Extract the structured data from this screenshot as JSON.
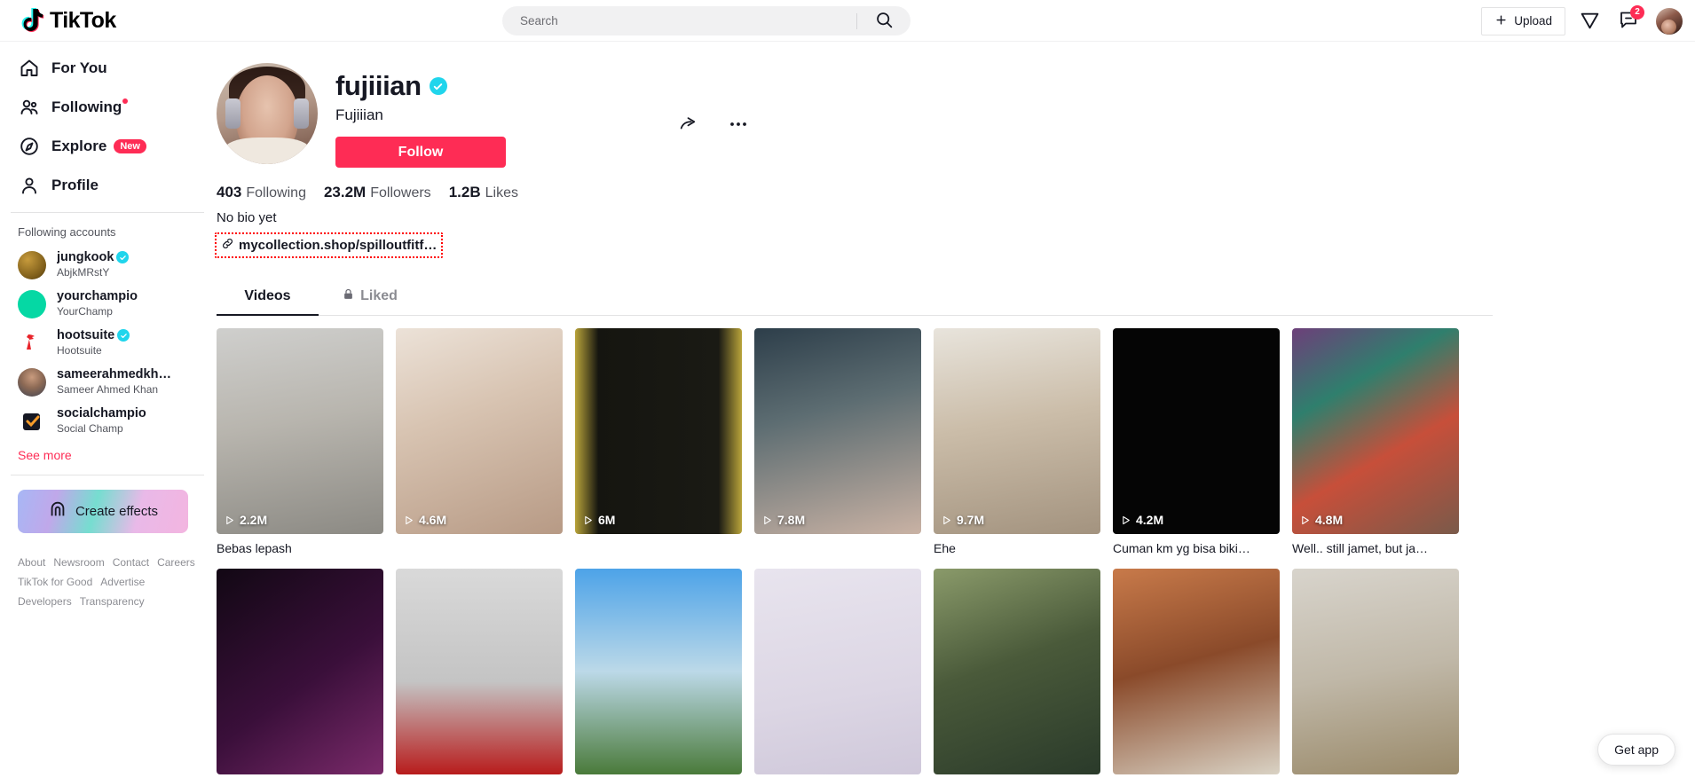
{
  "header": {
    "logo_text": "TikTok",
    "search_placeholder": "Search",
    "search_value": "",
    "upload_label": "Upload",
    "messages_badge": "2",
    "icons": {
      "search": "search-icon",
      "send": "paper-plane-icon",
      "message": "message-icon",
      "avatar": "user-avatar"
    }
  },
  "sidebar": {
    "nav": [
      {
        "label": "For You",
        "icon": "home-icon",
        "dot": false,
        "badge": ""
      },
      {
        "label": "Following",
        "icon": "people-icon",
        "dot": true,
        "badge": ""
      },
      {
        "label": "Explore",
        "icon": "compass-icon",
        "dot": false,
        "badge": "New"
      },
      {
        "label": "Profile",
        "icon": "person-icon",
        "dot": false,
        "badge": ""
      }
    ],
    "section_title": "Following accounts",
    "accounts": [
      {
        "username": "jungkook",
        "nickname": "AbjkMRstY",
        "verified": true
      },
      {
        "username": "yourchampio",
        "nickname": "YourChamp",
        "verified": false
      },
      {
        "username": "hootsuite",
        "nickname": "Hootsuite",
        "verified": true
      },
      {
        "username": "sameerahmedkh…",
        "nickname": "Sameer Ahmed Khan",
        "verified": false
      },
      {
        "username": "socialchampio",
        "nickname": "Social Champ",
        "verified": false
      }
    ],
    "see_more": "See more",
    "create_effects": "Create effects",
    "footer_rows": [
      [
        "About",
        "Newsroom",
        "Contact",
        "Careers"
      ],
      [
        "TikTok for Good",
        "Advertise"
      ],
      [
        "Developers",
        "Transparency"
      ]
    ]
  },
  "profile": {
    "username": "fujiiian",
    "verified": true,
    "nickname": "Fujiiian",
    "follow_label": "Follow",
    "stats": [
      {
        "value": "403",
        "label": "Following"
      },
      {
        "value": "23.2M",
        "label": "Followers"
      },
      {
        "value": "1.2B",
        "label": "Likes"
      }
    ],
    "bio": "No bio yet",
    "link": "mycollection.shop/spilloutfitf…",
    "link_highlight_color": "#ff0000",
    "share_icon": "share-arrow-icon",
    "more_icon": "more-options-icon"
  },
  "tabs": [
    {
      "label": "Videos",
      "active": true,
      "locked": false
    },
    {
      "label": "Liked",
      "active": false,
      "locked": true
    }
  ],
  "videos": [
    {
      "views": "2.2M",
      "caption": "Bebas lepash"
    },
    {
      "views": "4.6M",
      "caption": ""
    },
    {
      "views": "6M",
      "caption": ""
    },
    {
      "views": "7.8M",
      "caption": ""
    },
    {
      "views": "9.7M",
      "caption": "Ehe"
    },
    {
      "views": "4.2M",
      "caption": "Cuman km yg bisa biki…"
    },
    {
      "views": "4.8M",
      "caption": "Well.. still jamet, but ja…"
    },
    {
      "views": "",
      "caption": ""
    },
    {
      "views": "",
      "caption": ""
    },
    {
      "views": "",
      "caption": ""
    },
    {
      "views": "",
      "caption": ""
    },
    {
      "views": "",
      "caption": ""
    },
    {
      "views": "",
      "caption": ""
    },
    {
      "views": "",
      "caption": ""
    }
  ],
  "get_app": "Get app",
  "colors": {
    "brand_red": "#fe2c55",
    "verified_blue": "#20d5ec",
    "text": "#161823"
  }
}
